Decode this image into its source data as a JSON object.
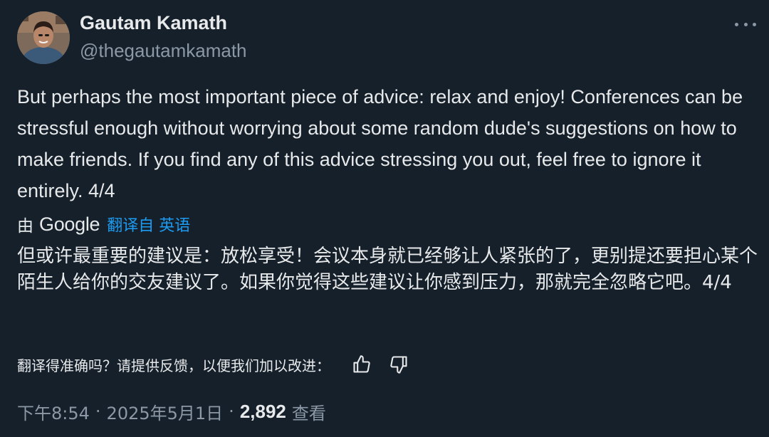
{
  "author": {
    "name": "Gautam Kamath",
    "handle": "@thegautamkamath"
  },
  "icons": {
    "more": "more-horizontal-icon",
    "thumbs_up": "thumbs-up-icon",
    "thumbs_down": "thumbs-down-icon",
    "google_logo": "google-logo"
  },
  "tweet": {
    "text": "But perhaps the most important piece of advice: relax and enjoy! Conferences can be stressful enough without worrying about some random dude's suggestions on how to make friends. If you find any of this advice stressing you out, feel free to ignore it entirely. 4/4"
  },
  "translation": {
    "by": "由",
    "provider": "Google",
    "link": "翻译自 英语",
    "text": "但或许最重要的建议是：放松享受！会议本身就已经够让人紧张的了，更别提还要担心某个陌生人给你的交友建议了。如果你觉得这些建议让你感到压力，那就完全忽略它吧。4/4",
    "feedback_question": "翻译得准确吗？请提供反馈，以便我们加以改进："
  },
  "meta": {
    "time": "下午8:54",
    "separator": "·",
    "date": "2025年5月1日",
    "views_count": "2,892",
    "views_label": "查看"
  },
  "colors": {
    "background": "#15202b",
    "text": "#e7e9ea",
    "secondary": "#8b98a5",
    "link": "#1d9bf0"
  }
}
